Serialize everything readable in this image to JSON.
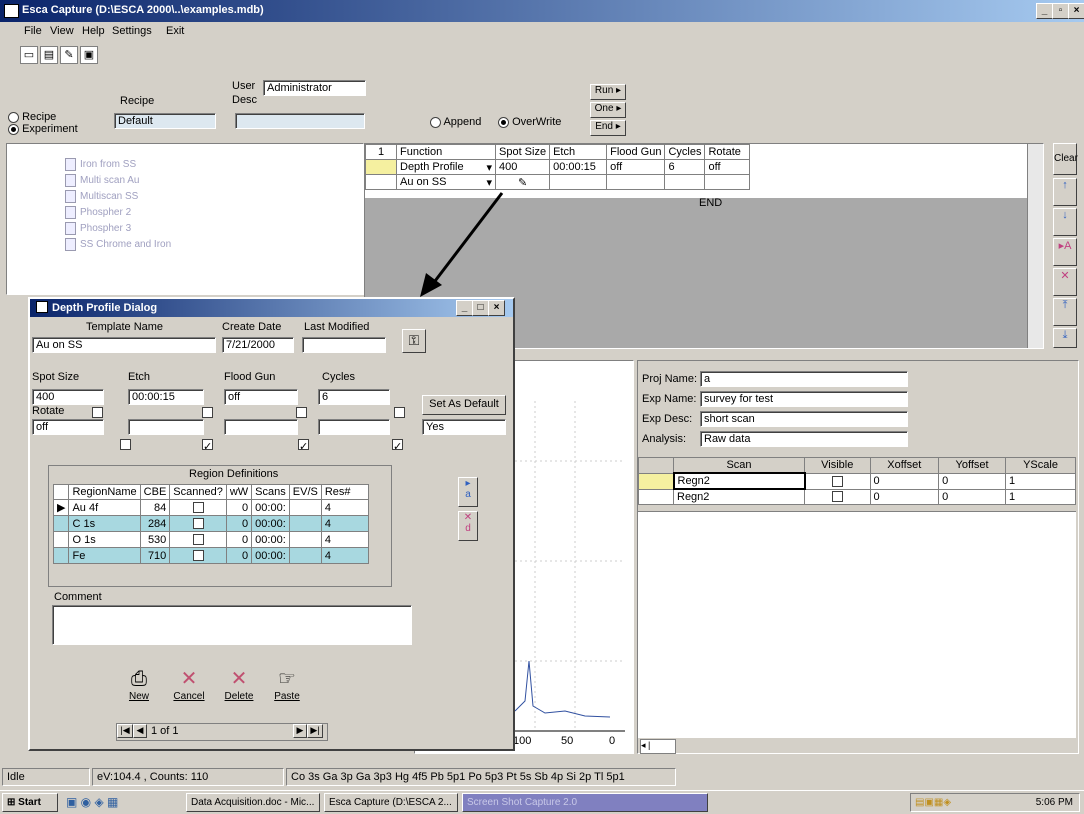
{
  "window": {
    "title": "Esca Capture (D:\\ESCA 2000\\..\\examples.mdb)",
    "min": "_",
    "max": "▫",
    "close": "×"
  },
  "menu": [
    "File",
    "View",
    "Help",
    "Settings",
    "Exit"
  ],
  "recipe_bar": {
    "radio_recipe": "Recipe",
    "radio_experiment": "Experiment",
    "recipe_label": "Recipe",
    "recipe_value": "Default",
    "user_label": "User",
    "user_value": "Administrator",
    "desc_label": "Desc",
    "append_label": "Append",
    "overwrite_label": "OverWrite",
    "run_label": "Run",
    "one_label": "One",
    "end_label": "End"
  },
  "tree": {
    "items": [
      "Iron from SS",
      "Multi scan Au",
      "Multiscan SS",
      "Phospher 2",
      "Phospher 3",
      "SS Chrome and Iron"
    ]
  },
  "function_table": {
    "row_num": "1",
    "headers": [
      "Function",
      "Spot Size",
      "Etch",
      "Flood Gun",
      "Cycles",
      "Rotate"
    ],
    "row1": [
      "Depth Profile",
      "400",
      "00:00:15",
      "off",
      "6",
      "off"
    ],
    "row2_function": "Au on SS",
    "end_label": "END"
  },
  "side_buttons": {
    "clear": "Clear"
  },
  "dialog": {
    "title": "Depth Profile Dialog",
    "template_name_label": "Template Name",
    "template_name": "Au on SS",
    "create_date_label": "Create Date",
    "create_date": "7/21/2000",
    "last_modified_label": "Last Modified",
    "spot_size_label": "Spot Size",
    "spot_size": "400",
    "etch_label": "Etch",
    "etch": "00:00:15",
    "flood_gun_label": "Flood Gun",
    "flood_gun": "off",
    "cycles_label": "Cycles",
    "cycles": "6",
    "rotate_label": "Rotate",
    "rotate": "off",
    "set_default_label": "Set As Default",
    "set_default_value": "Yes",
    "region_title": "Region Definitions",
    "region_headers": [
      "RegionName",
      "CBE",
      "Scanned?",
      "wW",
      "Scans",
      "EV/S",
      "Res#"
    ],
    "regions": [
      {
        "name": "Au 4f",
        "cbe": "84",
        "ww": "0",
        "scans": "00:00:",
        "res": "4"
      },
      {
        "name": "C 1s",
        "cbe": "284",
        "ww": "0",
        "scans": "00:00:",
        "res": "4"
      },
      {
        "name": "O 1s",
        "cbe": "530",
        "ww": "0",
        "scans": "00:00:",
        "res": "4"
      },
      {
        "name": "Fe",
        "cbe": "710",
        "ww": "0",
        "scans": "00:00:",
        "res": "4"
      }
    ],
    "side_a": "a",
    "side_d": "d",
    "comment_label": "Comment",
    "buttons": {
      "new": "New",
      "cancel": "Cancel",
      "delete": "Delete",
      "paste": "Paste"
    },
    "nav_record": "1 of 1"
  },
  "experiment": {
    "proj_name_label": "Proj Name:",
    "proj_name": "a",
    "exp_name_label": "Exp Name:",
    "exp_name": "survey for test",
    "exp_desc_label": "Exp Desc:",
    "exp_desc": "short scan",
    "analysis_label": "Analysis:",
    "analysis": "Raw data",
    "scan_headers": [
      "Scan",
      "Visible",
      "Xoffset",
      "Yoffset",
      "YScale"
    ],
    "scans": [
      {
        "scan": "Regn2",
        "x": "0",
        "y": "0",
        "s": "1"
      },
      {
        "scan": "Regn2",
        "x": "0",
        "y": "0",
        "s": "1"
      }
    ]
  },
  "plot": {
    "tick_100": "100",
    "tick_50": "50",
    "tick_0": "0"
  },
  "status": {
    "state": "Idle",
    "readout": "eV:104.4 , Counts: 110",
    "elements": "Co 3s Ga 3p Ga 3p3 Hg 4f5 Pb 5p1 Po 5p3 Pt 5s Sb 4p Si 2p Tl 5p1"
  },
  "taskbar": {
    "start": "Start",
    "tasks": [
      "Data Acquisition.doc - Mic...",
      "Esca Capture (D:\\ESCA 2...",
      "Screen Shot Capture 2.0"
    ],
    "clock": "5:06 PM"
  }
}
